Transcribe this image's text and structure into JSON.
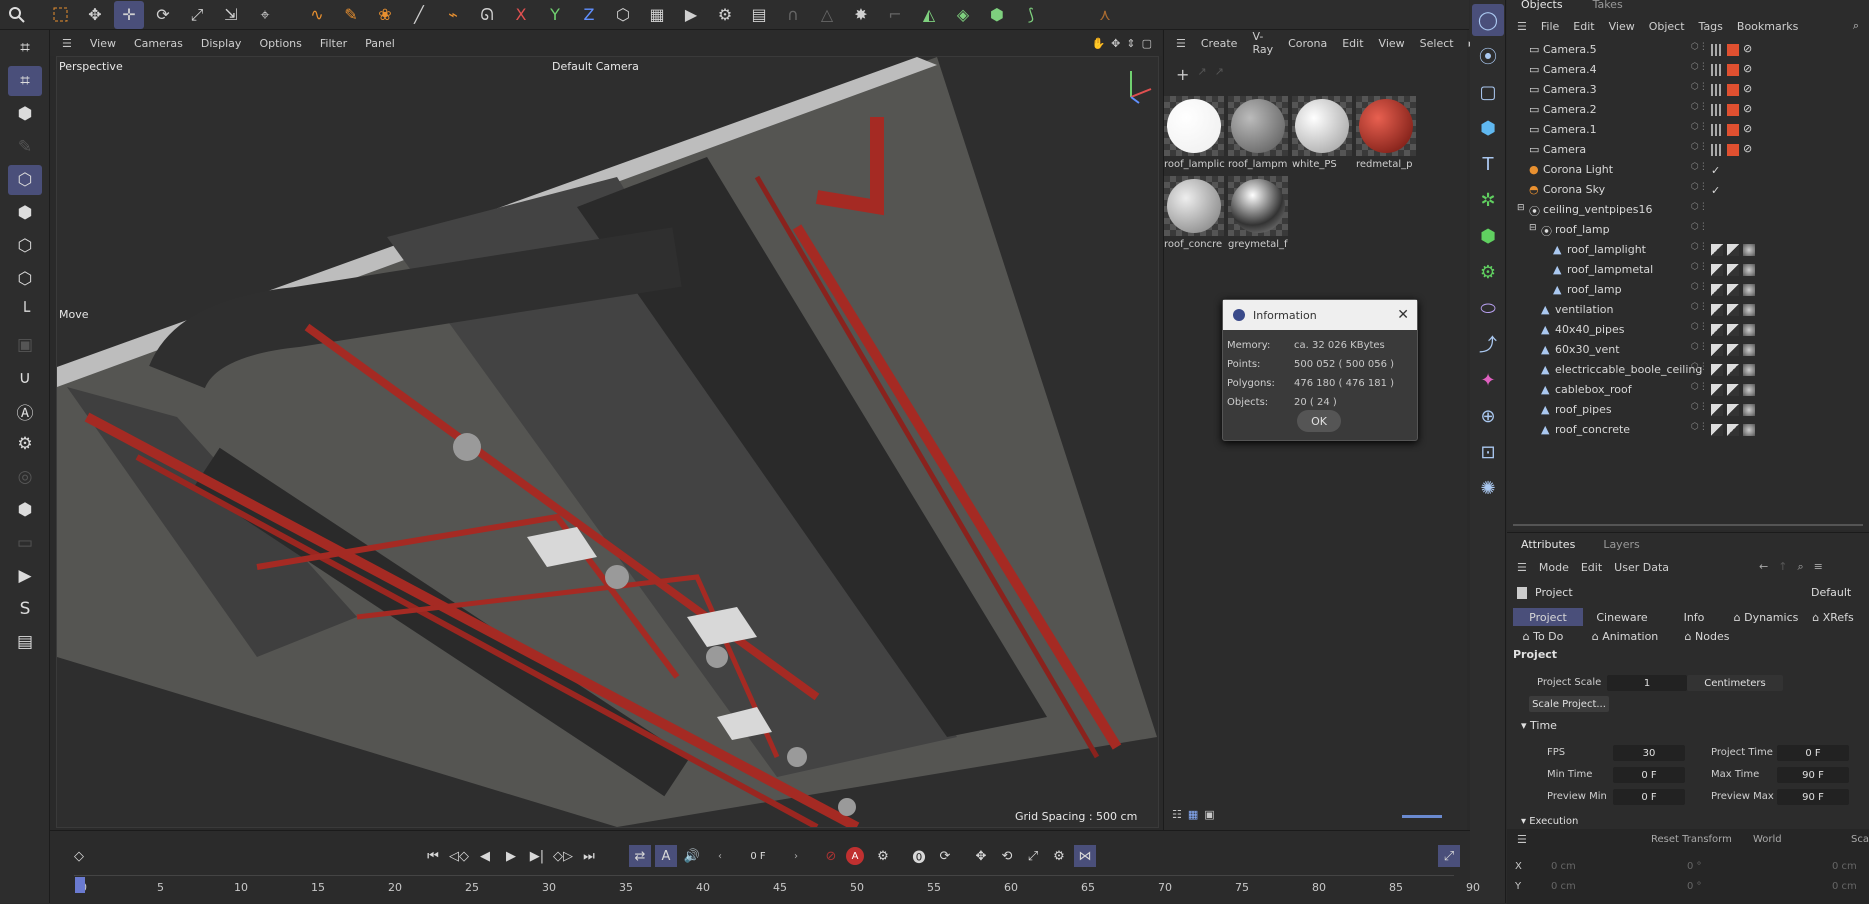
{
  "viewport": {
    "menu": [
      "View",
      "Cameras",
      "Display",
      "Options",
      "Filter",
      "Panel"
    ],
    "name": "Perspective",
    "camera": "Default Camera",
    "tool_label": "Move",
    "grid_spacing": "Grid Spacing : 500 cm"
  },
  "materials": {
    "menu": [
      "Create",
      "V-Ray",
      "Corona",
      "Edit",
      "View",
      "Select"
    ],
    "items": [
      {
        "label": "roof_lamplic",
        "color": "#ffffff"
      },
      {
        "label": "roof_lampm",
        "color": "#8a8a8a"
      },
      {
        "label": "white_PS",
        "color": "#e8e8e8"
      },
      {
        "label": "redmetal_p",
        "color": "#a8281e"
      },
      {
        "label": "roof_concre",
        "color": "#d0d0d0"
      },
      {
        "label": "greymetal_f",
        "color": "#7a7a7a"
      }
    ]
  },
  "dialog": {
    "title": "Information",
    "rows": [
      {
        "k": "Memory:",
        "v": "ca. 32 026 KBytes"
      },
      {
        "k": "Points:",
        "v": "500 052 ( 500 056 )"
      },
      {
        "k": "Polygons:",
        "v": "476 180 ( 476 181 )"
      },
      {
        "k": "Objects:",
        "v": "20 ( 24 )"
      }
    ],
    "ok": "OK"
  },
  "objects": {
    "tabs": [
      "Objects",
      "Takes"
    ],
    "menu": [
      "File",
      "Edit",
      "View",
      "Object",
      "Tags",
      "Bookmarks"
    ],
    "rows": [
      {
        "name": "Camera.5",
        "indent": 0,
        "type": "camera"
      },
      {
        "name": "Camera.4",
        "indent": 0,
        "type": "camera"
      },
      {
        "name": "Camera.3",
        "indent": 0,
        "type": "camera"
      },
      {
        "name": "Camera.2",
        "indent": 0,
        "type": "camera"
      },
      {
        "name": "Camera.1",
        "indent": 0,
        "type": "camera"
      },
      {
        "name": "Camera",
        "indent": 0,
        "type": "camera"
      },
      {
        "name": "Corona Light",
        "indent": 0,
        "type": "light"
      },
      {
        "name": "Corona Sky",
        "indent": 0,
        "type": "sky"
      },
      {
        "name": "ceiling_ventpipes16",
        "indent": 0,
        "type": "null"
      },
      {
        "name": "roof_lamp",
        "indent": 1,
        "type": "null"
      },
      {
        "name": "roof_lamplight",
        "indent": 2,
        "type": "poly"
      },
      {
        "name": "roof_lampmetal",
        "indent": 2,
        "type": "poly"
      },
      {
        "name": "roof_lamp",
        "indent": 2,
        "type": "poly"
      },
      {
        "name": "ventilation",
        "indent": 1,
        "type": "poly"
      },
      {
        "name": "40x40_pipes",
        "indent": 1,
        "type": "poly"
      },
      {
        "name": "60x30_vent",
        "indent": 1,
        "type": "poly"
      },
      {
        "name": "electriccable_boole_ceiling",
        "indent": 1,
        "type": "poly"
      },
      {
        "name": "cablebox_roof",
        "indent": 1,
        "type": "poly"
      },
      {
        "name": "roof_pipes",
        "indent": 1,
        "type": "poly"
      },
      {
        "name": "roof_concrete",
        "indent": 1,
        "type": "poly"
      }
    ]
  },
  "attributes": {
    "tabs": [
      "Attributes",
      "Layers"
    ],
    "menu": [
      "Mode",
      "Edit",
      "User Data"
    ],
    "object": "Project",
    "preset": "Default",
    "subtabs1": [
      "Project",
      "Cineware",
      "Info",
      "Dynamics",
      "XRefs"
    ],
    "subtabs2": [
      "To Do",
      "Animation",
      "Nodes"
    ],
    "section": "Project",
    "project_scale_label": "Project Scale",
    "project_scale_value": "1",
    "unit": "Centimeters",
    "scale_btn": "Scale Project...",
    "time_section": "Time",
    "fps_label": "FPS",
    "fps": "30",
    "ptime_label": "Project Time",
    "ptime": "0 F",
    "mintime_label": "Min Time",
    "mintime": "0 F",
    "maxtime_label": "Max Time",
    "maxtime": "90 F",
    "pmin_label": "Preview Min",
    "pmin": "0 F",
    "pmax_label": "Preview Max",
    "pmax": "90 F",
    "exec_section": "Execution",
    "reset": "Reset Transform",
    "world": "World",
    "sca": "Sca",
    "x": "X",
    "y": "Y",
    "xv": "0 cm",
    "xa": "0 °",
    "xs": "0 cm",
    "yv": "0 cm",
    "ya": "0 °",
    "ys": "0 cm"
  },
  "timeline": {
    "frame": "0 F",
    "ticks": [
      "0",
      "5",
      "10",
      "15",
      "20",
      "25",
      "30",
      "35",
      "40",
      "45",
      "50",
      "55",
      "60",
      "65",
      "70",
      "75",
      "80",
      "85",
      "90"
    ]
  }
}
